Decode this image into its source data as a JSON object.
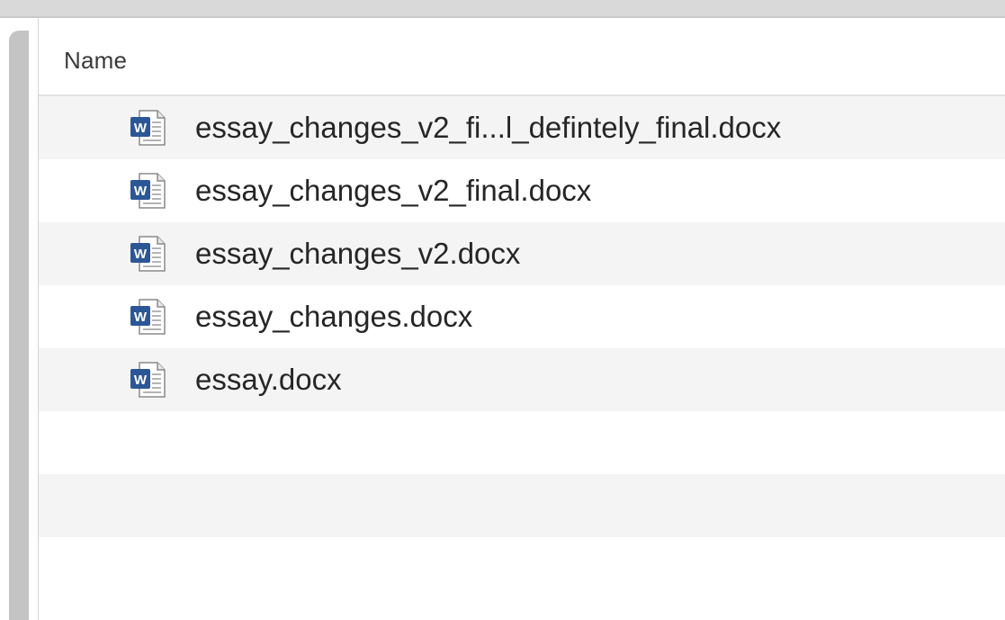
{
  "list": {
    "column_header": "Name",
    "files": [
      {
        "name": "essay_changes_v2_fi...l_defintely_final.docx",
        "icon": "word-document-icon"
      },
      {
        "name": "essay_changes_v2_final.docx",
        "icon": "word-document-icon"
      },
      {
        "name": "essay_changes_v2.docx",
        "icon": "word-document-icon"
      },
      {
        "name": "essay_changes.docx",
        "icon": "word-document-icon"
      },
      {
        "name": "essay.docx",
        "icon": "word-document-icon"
      }
    ]
  },
  "colors": {
    "row_stripe": "#f4f4f4",
    "word_blue": "#2b5797"
  }
}
